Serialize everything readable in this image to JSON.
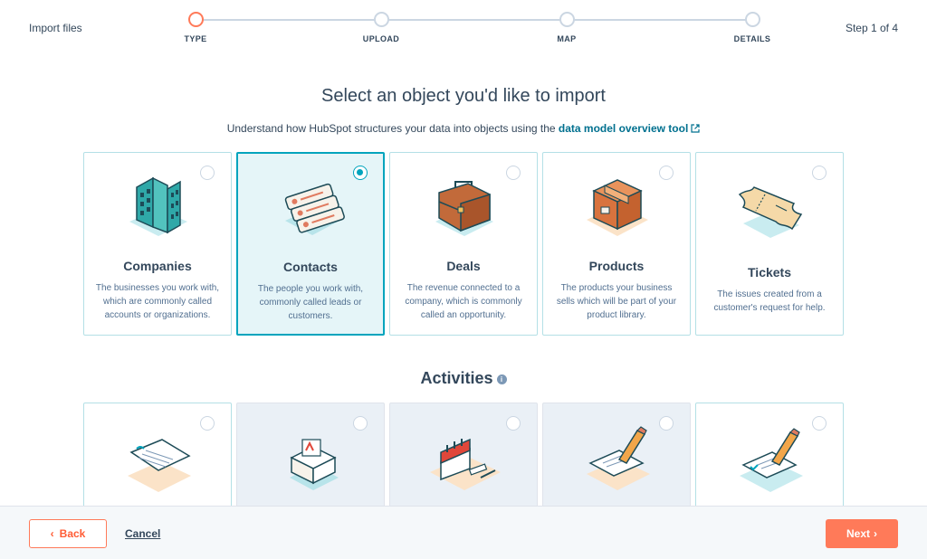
{
  "header": {
    "title": "Import files",
    "step_count": "Step 1 of 4",
    "steps": [
      {
        "label": "TYPE",
        "active": true
      },
      {
        "label": "UPLOAD",
        "active": false
      },
      {
        "label": "MAP",
        "active": false
      },
      {
        "label": "DETAILS",
        "active": false
      }
    ]
  },
  "main": {
    "title": "Select an object you'd like to import",
    "subtitle_prefix": "Understand how HubSpot structures your data into objects using the",
    "subtitle_link": "data model overview tool",
    "objects": [
      {
        "name": "Companies",
        "description": "The businesses you work with, which are commonly called accounts or organizations.",
        "selected": false,
        "icon": "building-icon"
      },
      {
        "name": "Contacts",
        "description": "The people you work with, commonly called leads or customers.",
        "selected": true,
        "icon": "contact-cards-icon"
      },
      {
        "name": "Deals",
        "description": "The revenue connected to a company, which is commonly called an opportunity.",
        "selected": false,
        "icon": "briefcase-icon"
      },
      {
        "name": "Products",
        "description": "The products your business sells which will be part of your product library.",
        "selected": false,
        "icon": "package-box-icon"
      },
      {
        "name": "Tickets",
        "description": "The issues created from a customer's request for help.",
        "selected": false,
        "icon": "ticket-icon"
      }
    ],
    "activities_title": "Activities",
    "activities": [
      {
        "icon": "call-log-icon",
        "shaded": false
      },
      {
        "icon": "email-envelope-icon",
        "shaded": true
      },
      {
        "icon": "meeting-calendar-icon",
        "shaded": true
      },
      {
        "icon": "note-pencil-icon",
        "shaded": true
      },
      {
        "icon": "task-checklist-icon",
        "shaded": false
      }
    ]
  },
  "footer": {
    "back_label": "Back",
    "cancel_label": "Cancel",
    "next_label": "Next"
  },
  "colors": {
    "accent": "#ff7a59",
    "teal": "#00a4bd",
    "link": "#00708f",
    "text": "#33475b"
  }
}
